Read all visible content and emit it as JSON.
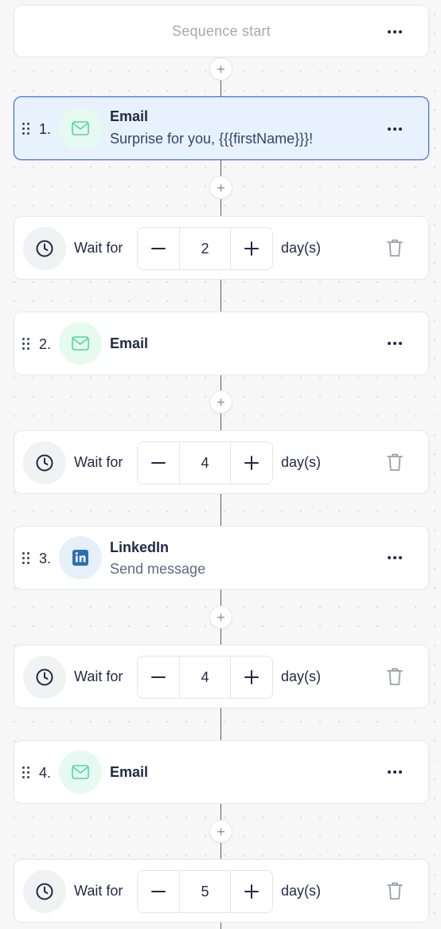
{
  "sequence": {
    "start_label": "Sequence start",
    "steps": [
      {
        "number": "1.",
        "type": "Email",
        "subtitle": "Surprise for you, {{{firstName}}}!"
      },
      {
        "number": "2.",
        "type": "Email",
        "subtitle": ""
      },
      {
        "number": "3.",
        "type": "LinkedIn",
        "subtitle": "Send message"
      },
      {
        "number": "4.",
        "type": "Email",
        "subtitle": ""
      }
    ],
    "waits": [
      {
        "label": "Wait for",
        "value": "2",
        "unit": "day(s)"
      },
      {
        "label": "Wait for",
        "value": "4",
        "unit": "day(s)"
      },
      {
        "label": "Wait for",
        "value": "4",
        "unit": "day(s)"
      },
      {
        "label": "Wait for",
        "value": "5",
        "unit": "day(s)"
      }
    ]
  },
  "icons": {
    "more": "more-horizontal-icon",
    "add": "plus-icon",
    "drag": "drag-handle-icon",
    "email": "mail-icon",
    "linkedin": "linkedin-icon",
    "clock": "clock-icon",
    "decrement": "minus-icon",
    "increment": "plus-icon",
    "delete": "trash-icon"
  },
  "colors": {
    "email_icon": "#4fd6a0",
    "linkedin_icon": "#2a6fb5",
    "selected_border": "#3b66e0",
    "selected_bg": "#e8f1fe"
  }
}
